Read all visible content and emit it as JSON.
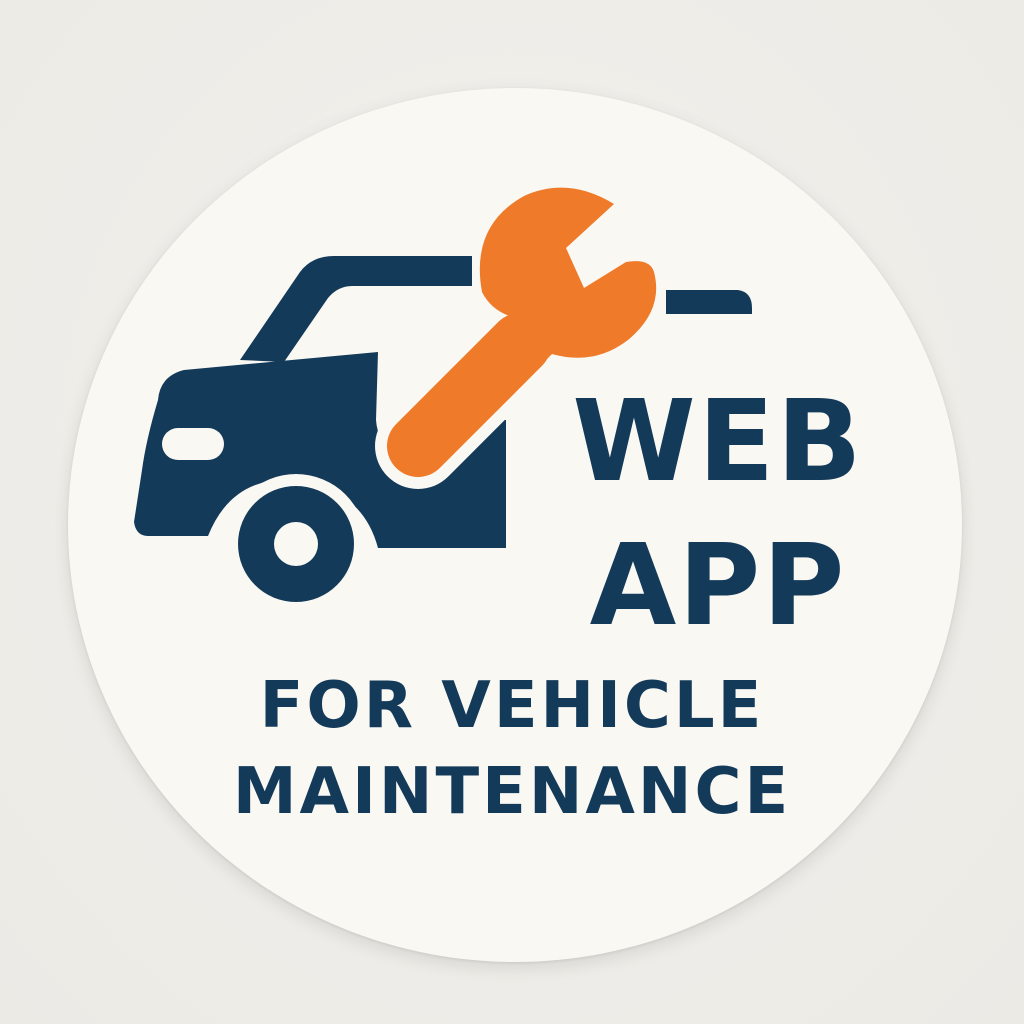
{
  "logo": {
    "title_line_1": "WEB",
    "title_line_2": "APP",
    "subtitle_line_1": "FOR VEHICLE",
    "subtitle_line_2": "MAINTENANCE"
  },
  "icons": [
    "car-icon",
    "wrench-icon"
  ],
  "colors": {
    "navy": "#143a5a",
    "orange": "#ee7a2a",
    "badge_background": "#faf8f3",
    "page_background": "#efede9"
  }
}
